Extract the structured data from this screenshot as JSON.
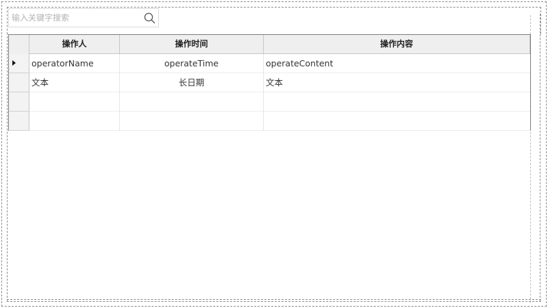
{
  "search": {
    "placeholder": "输入关键字搜索",
    "value": ""
  },
  "icons": {
    "search": "search-icon",
    "current_row": "current-row-pointer-icon"
  },
  "grid": {
    "columns": [
      "操作人",
      "操作时间",
      "操作内容"
    ],
    "rows": [
      [
        "operatorName",
        "operateTime",
        "operateContent"
      ],
      [
        "文本",
        "长日期",
        "文本"
      ],
      [
        "",
        "",
        ""
      ],
      [
        "",
        "",
        ""
      ]
    ],
    "current_row_index": 0
  }
}
